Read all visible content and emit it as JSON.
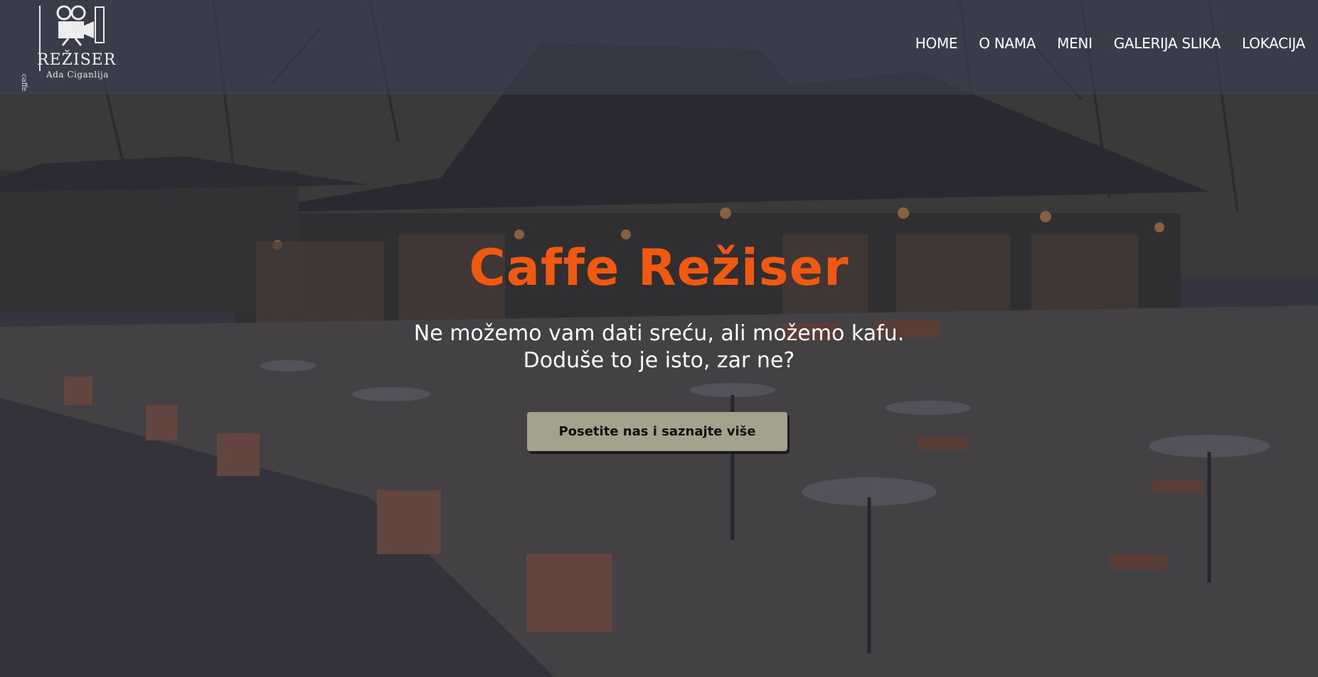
{
  "header": {
    "logo": {
      "brand": "REŽISER",
      "subtitle": "Ada Ciganlija",
      "vertical": "caffe",
      "icon": "film-camera-icon"
    },
    "nav": [
      {
        "label": "HOME"
      },
      {
        "label": "O NAMA"
      },
      {
        "label": "MENI"
      },
      {
        "label": "GALERIJA SLIKA"
      },
      {
        "label": "LOKACIJA"
      }
    ]
  },
  "hero": {
    "title": "Caffe Režiser",
    "tagline_line1": "Ne možemo vam dati sreću, ali možemo kafu.",
    "tagline_line2": "Doduše to je isto, zar ne?",
    "cta_label": "Posetite nas i saznajte više"
  },
  "colors": {
    "accent": "#f0590f",
    "header_bg": "#404254",
    "cta_bg": "#a4a28c",
    "text": "#ffffff"
  }
}
